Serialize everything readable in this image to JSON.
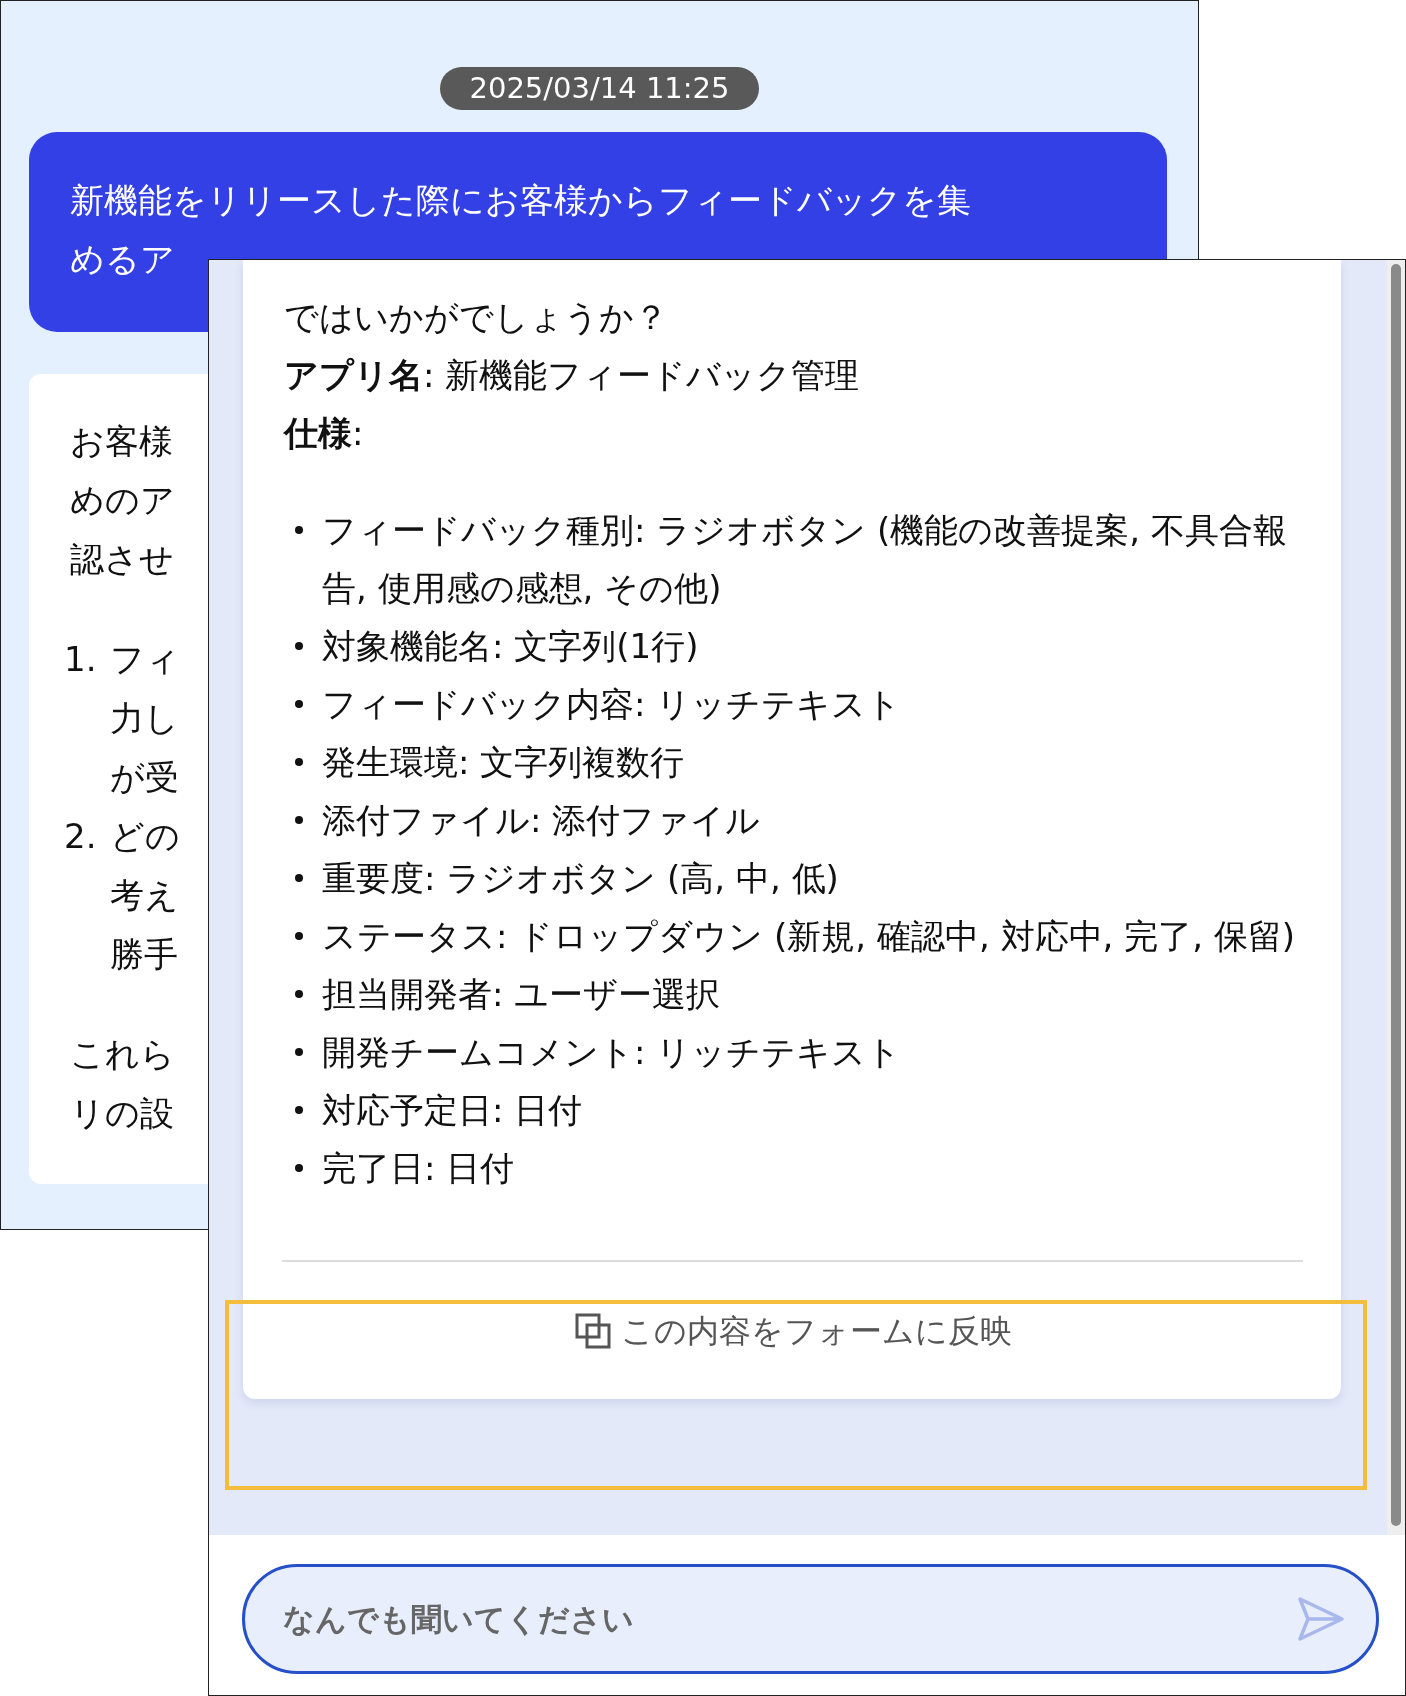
{
  "back_window": {
    "timestamp": "2025/03/14 11:25",
    "user_message": {
      "lines": [
        "新機能をリリースした際にお客様からフィードバックを集",
        "めるア"
      ]
    },
    "reply": {
      "intro_lines": [
        "お客様",
        "めのア",
        "認させ"
      ],
      "numbered": [
        {
          "marker": "1.",
          "lines": [
            "フィ",
            "力し",
            "が受"
          ]
        },
        {
          "marker": "2.",
          "lines": [
            "どの",
            "考え",
            "勝手"
          ]
        }
      ],
      "outro_lines": [
        "これら",
        "リの設"
      ]
    }
  },
  "front_window": {
    "reply": {
      "intro": "ではいかがでしょうか？",
      "app_name": "**アプリ名**: 新機能フィードバック管理",
      "spec_label": "**仕様**:",
      "spec_items": [
        "フィードバック種別: ラジオボタン (機能の改善提案, 不具合報告, 使用感の感想, その他)",
        "対象機能名: 文字列(1行)",
        "フィードバック内容: リッチテキスト",
        "発生環境: 文字列複数行",
        "添付ファイル: 添付ファイル",
        "重要度: ラジオボタン (高, 中, 低)",
        "ステータス: ドロップダウン (新規, 確認中, 対応中, 完了, 保留)",
        "担当開発者: ユーザー選択",
        "開発チームコメント: リッチテキスト",
        "対応予定日: 日付",
        "完了日: 日付"
      ]
    },
    "apply_button": "この内容をフォームに反映",
    "input": {
      "placeholder": "なんでも聞いてください"
    }
  }
}
